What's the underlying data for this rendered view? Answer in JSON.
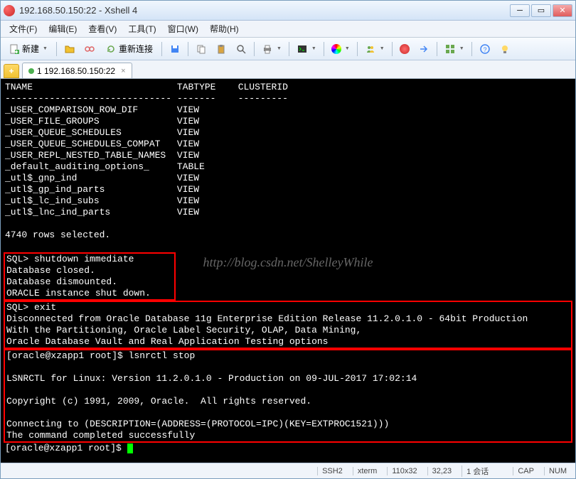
{
  "window": {
    "title": "192.168.50.150:22 - Xshell 4"
  },
  "menu": {
    "file": "文件(F)",
    "edit": "编辑(E)",
    "view": "查看(V)",
    "tools": "工具(T)",
    "window": "窗口(W)",
    "help": "帮助(H)"
  },
  "toolbar": {
    "new_label": "新建",
    "reconnect_label": "重新连接"
  },
  "tab": {
    "label": "1 192.168.50.150:22"
  },
  "terminal": {
    "header": {
      "col1": "TNAME",
      "col2": "TABTYPE",
      "col3": "CLUSTERID"
    },
    "rows": [
      {
        "name": "_USER_COMPARISON_ROW_DIF",
        "type": "VIEW"
      },
      {
        "name": "_USER_FILE_GROUPS",
        "type": "VIEW"
      },
      {
        "name": "_USER_QUEUE_SCHEDULES",
        "type": "VIEW"
      },
      {
        "name": "_USER_QUEUE_SCHEDULES_COMPAT",
        "type": "VIEW"
      },
      {
        "name": "_USER_REPL_NESTED_TABLE_NAMES",
        "type": "VIEW"
      },
      {
        "name": "_default_auditing_options_",
        "type": "TABLE"
      },
      {
        "name": "_utl$_gnp_ind",
        "type": "VIEW"
      },
      {
        "name": "_utl$_gp_ind_parts",
        "type": "VIEW"
      },
      {
        "name": "_utl$_lc_ind_subs",
        "type": "VIEW"
      },
      {
        "name": "_utl$_lnc_ind_parts",
        "type": "VIEW"
      }
    ],
    "summary": "4740 rows selected.",
    "box1": [
      "SQL> shutdown immediate",
      "Database closed.",
      "Database dismounted.",
      "ORACLE instance shut down."
    ],
    "box2": [
      "SQL> exit",
      "Disconnected from Oracle Database 11g Enterprise Edition Release 11.2.0.1.0 - 64bit Production",
      "With the Partitioning, Oracle Label Security, OLAP, Data Mining,",
      "Oracle Database Vault and Real Application Testing options"
    ],
    "box3": [
      "[oracle@xzapp1 root]$ lsnrctl stop",
      "",
      "LSNRCTL for Linux: Version 11.2.0.1.0 - Production on 09-JUL-2017 17:02:14",
      "",
      "Copyright (c) 1991, 2009, Oracle.  All rights reserved.",
      "",
      "Connecting to (DESCRIPTION=(ADDRESS=(PROTOCOL=IPC)(KEY=EXTPROC1521)))",
      "The command completed successfully"
    ],
    "prompt": "[oracle@xzapp1 root]$ ",
    "watermark": "http://blog.csdn.net/ShelleyWhile"
  },
  "status": {
    "conn": "SSH2",
    "term": "xterm",
    "size": "110x32",
    "pos": "32,23",
    "sess": "1 会话",
    "cap": "CAP",
    "num": "NUM"
  }
}
